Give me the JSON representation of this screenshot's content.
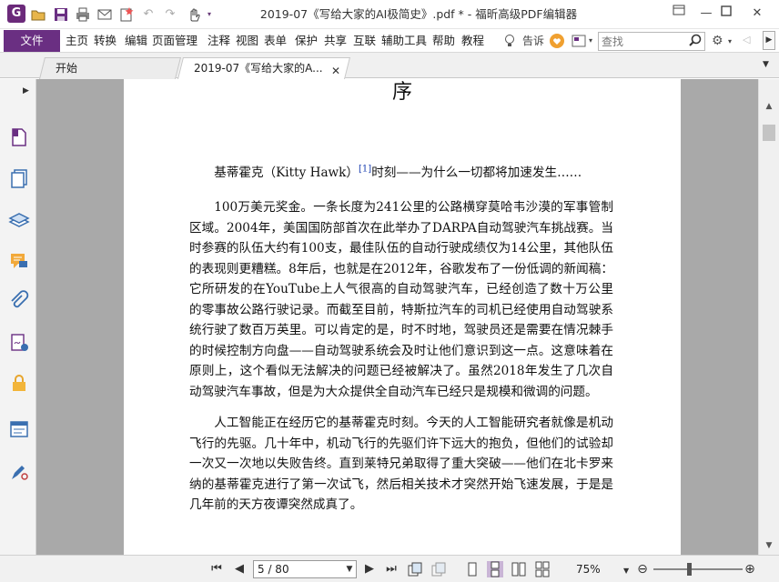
{
  "window": {
    "title": "2019-07《写给大家的AI极简史》.pdf * - 福昕高级PDF编辑器",
    "logo_letter": "G"
  },
  "menu": {
    "file_label": "文件",
    "items": [
      "主页",
      "转换",
      "编辑",
      "页面管理",
      "注释",
      "视图",
      "表单",
      "保护",
      "共享",
      "互联",
      "辅助工具",
      "帮助",
      "教程"
    ],
    "tell_me": "告诉",
    "search_placeholder": "查找"
  },
  "tabs": [
    {
      "label": "开始",
      "active": false
    },
    {
      "label": "2019-07《写给大家的A...",
      "active": true
    }
  ],
  "document": {
    "heading": "序",
    "subtitle": "基蒂霍克（Kitty Hawk）",
    "footnote_ref": "[1]",
    "subtitle_rest": "时刻——为什么一切都将加速发生……",
    "paragraphs": [
      "100万美元奖金。一条长度为241公里的公路横穿莫哈韦沙漠的军事管制区域。2004年，美国国防部首次在此举办了DARPA自动驾驶汽车挑战赛。当时参赛的队伍大约有100支，最佳队伍的自动行驶成绩仅为14公里，其他队伍的表现则更糟糕。8年后，也就是在2012年，谷歌发布了一份低调的新闻稿：它所研发的在YouTube上人气很高的自动驾驶汽车，已经创造了数十万公里的零事故公路行驶记录。而截至目前，特斯拉汽车的司机已经使用自动驾驶系统行驶了数百万英里。可以肯定的是，时不时地，驾驶员还是需要在情况棘手的时候控制方向盘——自动驾驶系统会及时让他们意识到这一点。这意味着在原则上，这个看似无法解决的问题已经被解决了。虽然2018年发生了几次自动驾驶汽车事故，但是为大众提供全自动汽车已经只是规模和微调的问题。",
      "人工智能正在经历它的基蒂霍克时刻。今天的人工智能研究者就像是机动飞行的先驱。几十年中，机动飞行的先驱们许下远大的抱负，但他们的试验却一次又一次地以失败告终。直到莱特兄弟取得了重大突破——他们在北卡罗来纳的基蒂霍克进行了第一次试飞，然后相关技术才突然开始飞速发展，于是是几年前的天方夜谭突然成真了。"
    ]
  },
  "status": {
    "page_display": "5 / 80",
    "current_page": 5,
    "total_pages": 80,
    "zoom": "75%",
    "zoom_level": 0.4
  },
  "colors": {
    "brand": "#6a2f82",
    "canvas": "#a9a9a9",
    "footnote": "#1a3fb0"
  }
}
